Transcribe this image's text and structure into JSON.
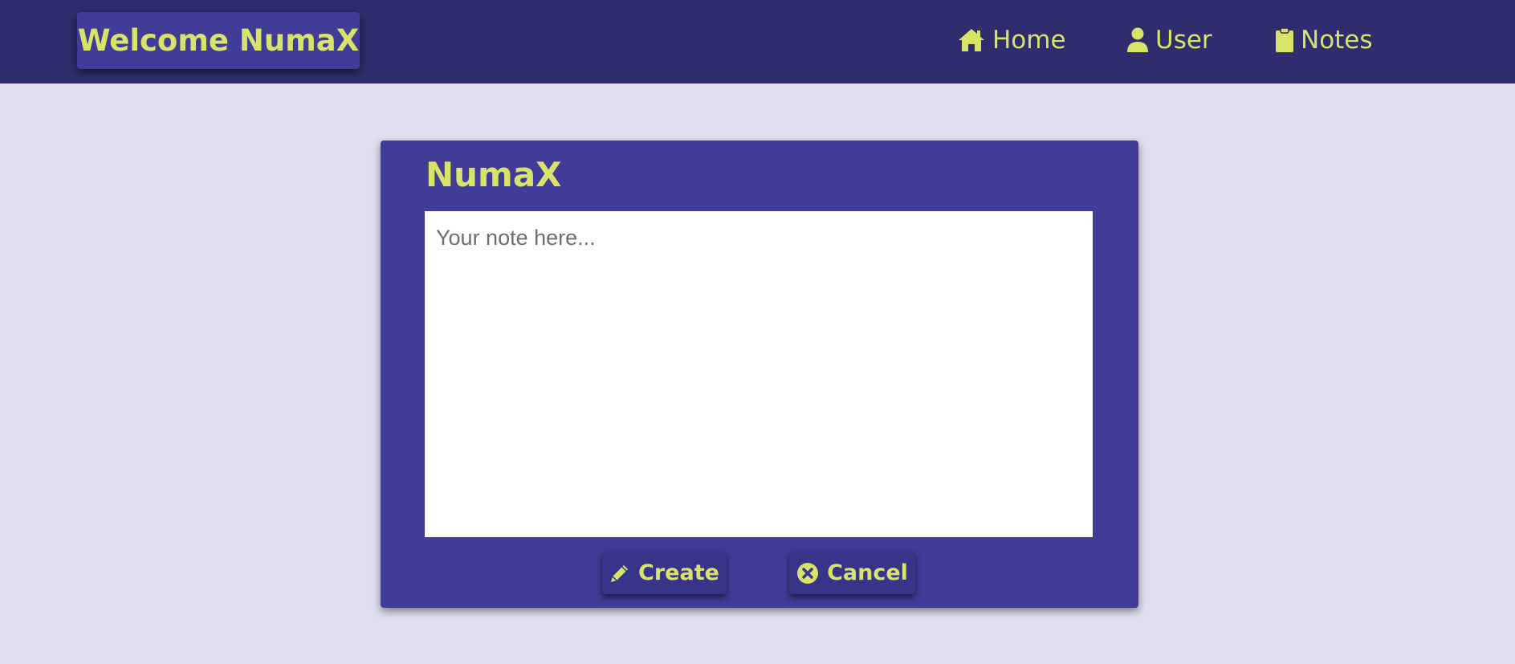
{
  "navbar": {
    "brand": "Welcome NumaX",
    "links": [
      {
        "label": "Home",
        "icon": "home-icon"
      },
      {
        "label": "User",
        "icon": "user-icon"
      },
      {
        "label": "Notes",
        "icon": "clipboard-icon"
      }
    ]
  },
  "note_card": {
    "title": "NumaX",
    "textarea": {
      "value": "",
      "placeholder": "Your note here..."
    },
    "create_label": "Create",
    "create_icon": "pencil-icon",
    "cancel_label": "Cancel",
    "cancel_icon": "times-circle-icon"
  },
  "colors": {
    "navbar_bg": "#2f2d6e",
    "card_bg": "#403c98",
    "accent_text": "#d8e36a",
    "page_bg": "#dedeee"
  }
}
